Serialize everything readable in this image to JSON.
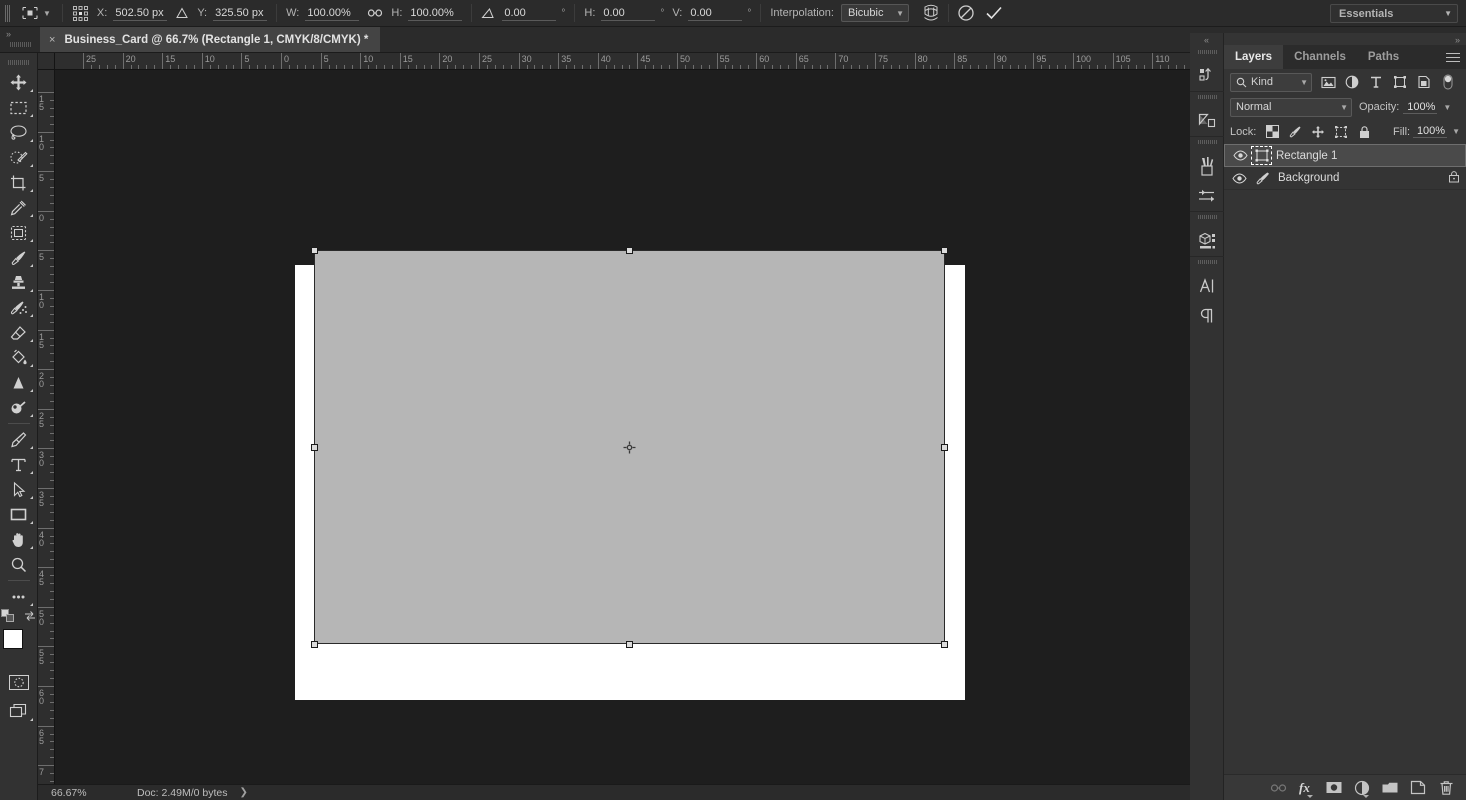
{
  "options_bar": {
    "tool_icon": "move-tool-icon",
    "tool_chevron": "chevron-down-icon",
    "ref_point_icon": "reference-point-grid-icon",
    "x_label": "X:",
    "x_value": "502.50 px",
    "delta_icon": "delta-triangle-icon",
    "y_label": "Y:",
    "y_value": "325.50 px",
    "w_label": "W:",
    "w_value": "100.00%",
    "link_icon": "link-chain-icon",
    "h_label": "H:",
    "h_value": "100.00%",
    "angle_icon": "rotate-angle-icon",
    "angle_value": "0.00",
    "angle_unit": "°",
    "skew_h_label": "H:",
    "skew_h_value": "0.00",
    "skew_h_unit": "°",
    "skew_v_label": "V:",
    "skew_v_value": "0.00",
    "skew_v_unit": "°",
    "interpolation_label": "Interpolation:",
    "interpolation_value": "Bicubic",
    "interpolation_chevron": "chevron-down-icon",
    "warp_icon": "warp-mode-icon",
    "cancel_icon": "cancel-transform-icon",
    "commit_icon": "commit-transform-checkmark-icon",
    "workspace": "Essentials",
    "workspace_chevron": "chevron-down-icon"
  },
  "tab_bar": {
    "collapse_icon": "double-chevron-right-icon",
    "close_icon": "×",
    "title": "Business_Card @ 66.7% (Rectangle 1, CMYK/8/CMYK) *"
  },
  "toolbar": {
    "tools": [
      {
        "name": "move-tool",
        "icon": "move-arrows-icon",
        "has_flyout": true,
        "selected": false
      },
      {
        "name": "rectangular-marquee-tool",
        "icon": "dashed-rectangle-icon",
        "has_flyout": true,
        "selected": false
      },
      {
        "name": "lasso-tool",
        "icon": "lasso-icon",
        "has_flyout": true,
        "selected": false
      },
      {
        "name": "quick-selection-tool",
        "icon": "quick-selection-icon",
        "has_flyout": true,
        "selected": false
      },
      {
        "name": "crop-tool",
        "icon": "crop-icon",
        "has_flyout": true,
        "selected": false
      },
      {
        "name": "eyedropper-tool",
        "icon": "eyedropper-icon",
        "has_flyout": true,
        "selected": false
      },
      {
        "name": "frame-tool",
        "icon": "frame-icon",
        "has_flyout": true,
        "selected": false
      },
      {
        "name": "brush-tool",
        "icon": "paintbrush-icon",
        "has_flyout": true,
        "selected": false
      },
      {
        "name": "clone-stamp-tool",
        "icon": "clone-stamp-icon",
        "has_flyout": true,
        "selected": false
      },
      {
        "name": "history-brush-tool",
        "icon": "history-brush-icon",
        "has_flyout": true,
        "selected": false
      },
      {
        "name": "eraser-tool",
        "icon": "eraser-icon",
        "has_flyout": true,
        "selected": false
      },
      {
        "name": "gradient-tool",
        "icon": "paint-bucket-icon",
        "has_flyout": true,
        "selected": false
      },
      {
        "name": "blur-tool",
        "icon": "blur-cone-icon",
        "has_flyout": true,
        "selected": false
      },
      {
        "name": "dodge-tool",
        "icon": "dodge-icon",
        "has_flyout": true,
        "selected": false
      },
      {
        "name": "pen-tool",
        "icon": "pen-nib-icon",
        "has_flyout": true,
        "selected": false
      },
      {
        "name": "type-tool",
        "icon": "type-T-icon",
        "has_flyout": true,
        "selected": false
      },
      {
        "name": "path-selection-tool",
        "icon": "path-arrow-icon",
        "has_flyout": true,
        "selected": false
      },
      {
        "name": "rectangle-tool",
        "icon": "rectangle-shape-icon",
        "has_flyout": true,
        "selected": false
      },
      {
        "name": "hand-tool",
        "icon": "hand-icon",
        "has_flyout": true,
        "selected": false
      },
      {
        "name": "zoom-tool",
        "icon": "magnifier-icon",
        "has_flyout": false,
        "selected": false
      },
      {
        "name": "edit-toolbar",
        "icon": "ellipsis-icon",
        "has_flyout": true,
        "selected": false
      }
    ],
    "default_colors_icon": "default-foreground-background-icon",
    "swap_colors_icon": "swap-colors-arrow-icon",
    "foreground_color": "#ffffff",
    "background_color": "#f0ece4",
    "quickmask_icon": "quick-mask-mode-icon",
    "screenmode_icon": "screen-mode-icon"
  },
  "rulers": {
    "unit": "cm",
    "horizontal_labels": [
      "25",
      "20",
      "15",
      "10",
      "5",
      "0",
      "5",
      "10",
      "15",
      "20",
      "25",
      "30",
      "35",
      "40",
      "45",
      "50",
      "55",
      "60",
      "65",
      "70",
      "75",
      "80",
      "85",
      "90",
      "95",
      "100",
      "105",
      "110"
    ],
    "vertical_labels": [
      "15",
      "10",
      "5",
      "0",
      "5",
      "10",
      "15",
      "20",
      "25",
      "30",
      "35",
      "40",
      "45",
      "50",
      "55",
      "60",
      "65",
      "7"
    ]
  },
  "canvas": {
    "page_background": "#ffffff",
    "shape_fill": "#b6b6b6",
    "selection_handles": 8,
    "reference_point_icon": "transform-reference-point-icon"
  },
  "status_bar": {
    "zoom": "66.67%",
    "doc_info": "Doc: 2.49M/0 bytes",
    "expand_icon": "chevron-right-icon"
  },
  "dock_strip": {
    "collapse_icon": "double-chevron-left-icon",
    "icons": [
      {
        "name": "libraries-panel-icon",
        "glyph": "libraries"
      },
      {
        "name": "adjustments-panel-icon",
        "glyph": "adjustments"
      },
      {
        "name": "brushes-panel-icon",
        "glyph": "brushes"
      },
      {
        "name": "brush-settings-panel-icon",
        "glyph": "brush-settings"
      },
      {
        "name": "3d-panel-icon",
        "glyph": "cube"
      },
      {
        "name": "character-panel-icon",
        "glyph": "character-A"
      },
      {
        "name": "paragraph-panel-icon",
        "glyph": "pilcrow"
      }
    ]
  },
  "layers_panel": {
    "expand_icon": "double-chevron-right-icon",
    "tabs": [
      {
        "label": "Layers",
        "active": true
      },
      {
        "label": "Channels",
        "active": false
      },
      {
        "label": "Paths",
        "active": false
      }
    ],
    "menu_icon": "panel-menu-hamburger-icon",
    "filter": {
      "search_icon": "search-magnifier-icon",
      "kind_label": "Kind",
      "chevron_icon": "chevron-down-icon",
      "type_filters": [
        {
          "name": "filter-pixel-layers-icon"
        },
        {
          "name": "filter-adjustment-layers-icon"
        },
        {
          "name": "filter-type-layers-icon"
        },
        {
          "name": "filter-shape-layers-icon"
        },
        {
          "name": "filter-smart-objects-icon"
        }
      ],
      "toggle_icon": "filter-enable-toggle-icon"
    },
    "blend_mode": "Normal",
    "blend_chevron": "chevron-down-icon",
    "opacity_label": "Opacity:",
    "opacity_value": "100%",
    "opacity_chevron": "chevron-down-icon",
    "lock_label": "Lock:",
    "lock_icons": [
      {
        "name": "lock-transparent-pixels-icon"
      },
      {
        "name": "lock-image-pixels-brush-icon"
      },
      {
        "name": "lock-position-move-icon"
      },
      {
        "name": "lock-artboard-nesting-icon"
      },
      {
        "name": "lock-all-padlock-icon"
      }
    ],
    "fill_label": "Fill:",
    "fill_value": "100%",
    "fill_chevron": "chevron-down-icon",
    "layers": [
      {
        "name": "Rectangle 1",
        "visible": true,
        "selected": true,
        "thumb_icon": "shape-layer-thumbnail-icon",
        "locked": false
      },
      {
        "name": "Background",
        "visible": true,
        "selected": false,
        "thumb_icon": "background-layer-brush-thumbnail-icon",
        "locked": true,
        "lock_icon": "padlock-icon"
      }
    ],
    "footer_icons": [
      {
        "name": "link-layers-icon",
        "disabled": true
      },
      {
        "name": "layer-styles-fx-icon",
        "disabled": false
      },
      {
        "name": "add-layer-mask-icon",
        "disabled": false
      },
      {
        "name": "new-adjustment-layer-icon",
        "disabled": false
      },
      {
        "name": "new-group-folder-icon",
        "disabled": false
      },
      {
        "name": "new-layer-icon",
        "disabled": false
      },
      {
        "name": "delete-layer-trash-icon",
        "disabled": false
      }
    ]
  }
}
